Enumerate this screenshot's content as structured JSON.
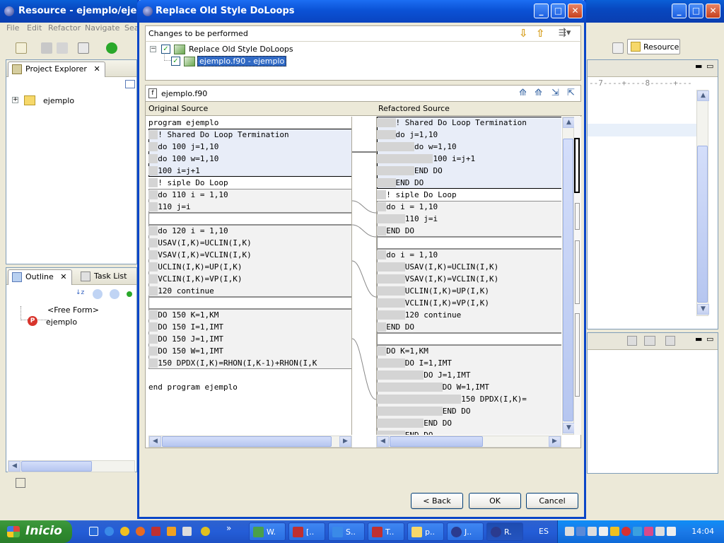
{
  "background_window": {
    "title": "Resource - ejemplo/ejemplo",
    "menu": [
      "File",
      "Edit",
      "Refactor",
      "Navigate",
      "Search"
    ],
    "perspective_label": "Resource",
    "project_explorer": {
      "tab": "Project Explorer",
      "items": [
        "ejemplo"
      ]
    },
    "outline": {
      "tabs": [
        "Outline",
        "Task List"
      ],
      "items": [
        "<Free Form>",
        "ejemplo"
      ]
    },
    "ruler_text": "--7----+----8-----+---"
  },
  "dialog": {
    "title": "Replace Old Style DoLoops",
    "changes_label": "Changes to be performed",
    "tree": [
      {
        "label": "Replace Old Style DoLoops",
        "checked": true
      },
      {
        "label": "ejemplo.f90 - ejemplo",
        "checked": true,
        "selected": true
      }
    ],
    "file_label": "ejemplo.f90",
    "original_title": "Original Source",
    "refactored_title": "Refactored Source",
    "original_lines": [
      "program ejemplo",
      "  ! Shared Do Loop Termination",
      "  do 100 j=1,10",
      "  do 100 w=1,10",
      "  100 i=j+1",
      "  ! siple Do Loop",
      "  do 110 i = 1,10",
      "  110 j=i",
      "",
      "  do 120 i = 1,10",
      "  USAV(I,K)=UCLIN(I,K)",
      "  VSAV(I,K)=VCLIN(I,K)",
      "  UCLIN(I,K)=UP(I,K)",
      "  VCLIN(I,K)=VP(I,K)",
      "  120 continue",
      "",
      "  DO 150 K=1,KM",
      "  DO 150 I=1,IMT",
      "  DO 150 J=1,IMT",
      "  DO 150 W=1,IMT",
      "  150 DPDX(I,K)=RHON(I,K-1)+RHON(I,K",
      "",
      "end program ejemplo"
    ],
    "refactored_lines": [
      "    ! Shared Do Loop Termination",
      "    do j=1,10",
      "        do w=1,10",
      "            100 i=j+1",
      "        END DO",
      "    END DO",
      "  ! siple Do Loop",
      "  do i = 1,10",
      "      110 j=i",
      "  END DO",
      "",
      "  do i = 1,10",
      "      USAV(I,K)=UCLIN(I,K)",
      "      VSAV(I,K)=VCLIN(I,K)",
      "      UCLIN(I,K)=UP(I,K)",
      "      VCLIN(I,K)=VP(I,K)",
      "      120 continue",
      "  END DO",
      "",
      "  DO K=1,KM",
      "      DO I=1,IMT",
      "          DO J=1,IMT",
      "              DO W=1,IMT",
      "                  150 DPDX(I,K)=",
      "              END DO",
      "          END DO",
      "      END DO"
    ],
    "buttons": {
      "back": "< Back",
      "ok": "OK",
      "cancel": "Cancel"
    }
  },
  "taskbar": {
    "start_label": "Inicio",
    "items": [
      "W.",
      "[..",
      "S..",
      "T..",
      "p..",
      "J..",
      "R."
    ],
    "language": "ES",
    "clock": "14:04"
  }
}
